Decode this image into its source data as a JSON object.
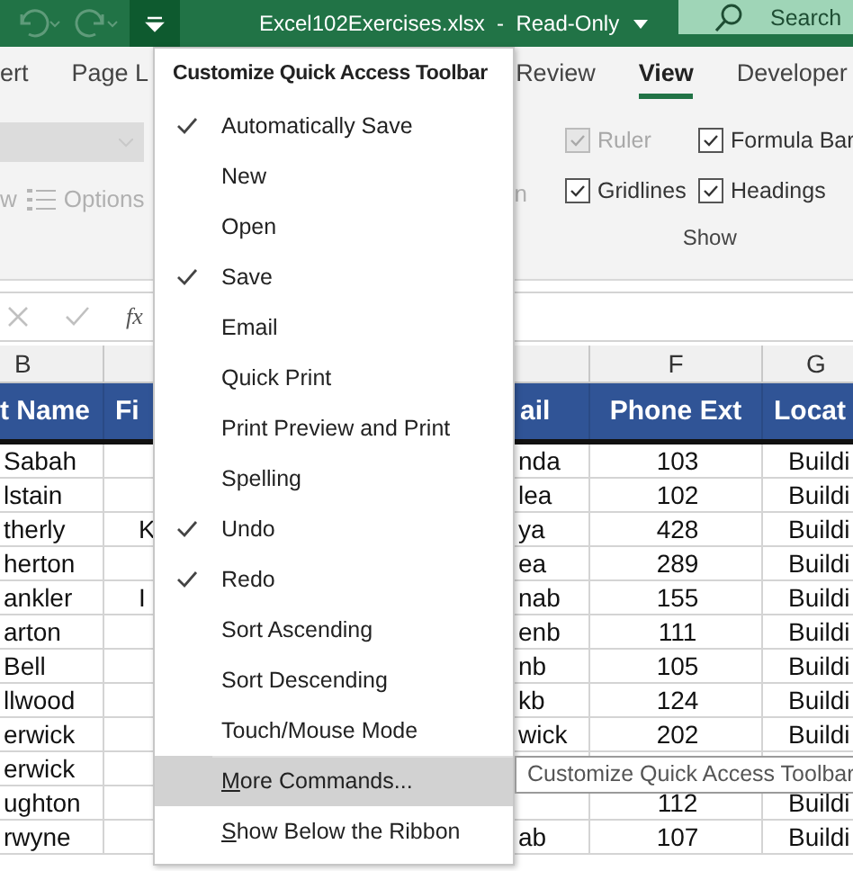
{
  "title_bar": {
    "customize_button": {
      "pressed": true
    },
    "file_title": "Excel102Exercises.xlsx  -  Read-Only",
    "search": {
      "placeholder": "Search"
    }
  },
  "ribbon_tabs": [
    {
      "label": "ert",
      "selected": false
    },
    {
      "label": "Page L",
      "selected": false
    },
    {
      "label": "Review",
      "selected": false
    },
    {
      "label": "View",
      "selected": true
    },
    {
      "label": "Developer",
      "selected": false
    }
  ],
  "ribbon": {
    "fragment_left": "w",
    "options_label": "Options",
    "fragment_mid": "n",
    "group_label": "Show",
    "checkboxes": [
      {
        "label": "Ruler",
        "checked": true,
        "disabled": true
      },
      {
        "label": "Formula Bar",
        "checked": true,
        "disabled": false
      },
      {
        "label": "Gridlines",
        "checked": true,
        "disabled": false
      },
      {
        "label": "Headings",
        "checked": true,
        "disabled": false
      }
    ]
  },
  "formula_bar": {
    "function_label": "fx"
  },
  "sheet": {
    "column_letters": [
      "B",
      "F",
      "G"
    ],
    "header": [
      "t Name",
      "Fi",
      "ail",
      "Phone Ext",
      "Locat"
    ],
    "rows": [
      [
        "Sabah",
        "",
        "nda",
        "103",
        "Buildi"
      ],
      [
        "lstain",
        "",
        "lea",
        "102",
        "Buildi"
      ],
      [
        "therly",
        "K",
        "ya",
        "428",
        "Buildi"
      ],
      [
        "herton",
        "",
        "ea",
        "289",
        "Buildi"
      ],
      [
        "ankler",
        "I",
        "nab",
        "155",
        "Buildi"
      ],
      [
        "arton",
        "",
        "enb",
        "111",
        "Buildi"
      ],
      [
        "Bell",
        "",
        "nb",
        "105",
        "Buildi"
      ],
      [
        "llwood",
        "",
        "kb",
        "124",
        "Buildi"
      ],
      [
        "erwick",
        "",
        "wick",
        "202",
        "Buildi"
      ],
      [
        "erwick",
        "",
        "",
        "",
        ""
      ],
      [
        "ughton",
        "",
        "",
        "112",
        "Buildi"
      ],
      [
        "rwyne",
        "",
        "ab",
        "107",
        "Buildi"
      ]
    ]
  },
  "menu": {
    "title": "Customize Quick Access Toolbar",
    "items": [
      {
        "label": "Automatically Save",
        "checked": true,
        "hovered": false
      },
      {
        "label": "New",
        "checked": false,
        "hovered": false
      },
      {
        "label": "Open",
        "checked": false,
        "hovered": false
      },
      {
        "label": "Save",
        "checked": true,
        "hovered": false
      },
      {
        "label": "Email",
        "checked": false,
        "hovered": false
      },
      {
        "label": "Quick Print",
        "checked": false,
        "hovered": false
      },
      {
        "label": "Print Preview and Print",
        "checked": false,
        "hovered": false
      },
      {
        "label": "Spelling",
        "checked": false,
        "hovered": false
      },
      {
        "label": "Undo",
        "checked": true,
        "hovered": false
      },
      {
        "label": "Redo",
        "checked": true,
        "hovered": false
      },
      {
        "label": "Sort Ascending",
        "checked": false,
        "hovered": false
      },
      {
        "label": "Sort Descending",
        "checked": false,
        "hovered": false
      },
      {
        "label": "Touch/Mouse Mode",
        "checked": false,
        "hovered": false
      },
      {
        "access_key": "M",
        "label": "ore Commands...",
        "checked": false,
        "hovered": true,
        "separator_before": true
      },
      {
        "access_key": "S",
        "label": "how Below the Ribbon",
        "checked": false,
        "hovered": false
      }
    ]
  },
  "tooltip": {
    "text": "Customize Quick Access Toolbar"
  }
}
